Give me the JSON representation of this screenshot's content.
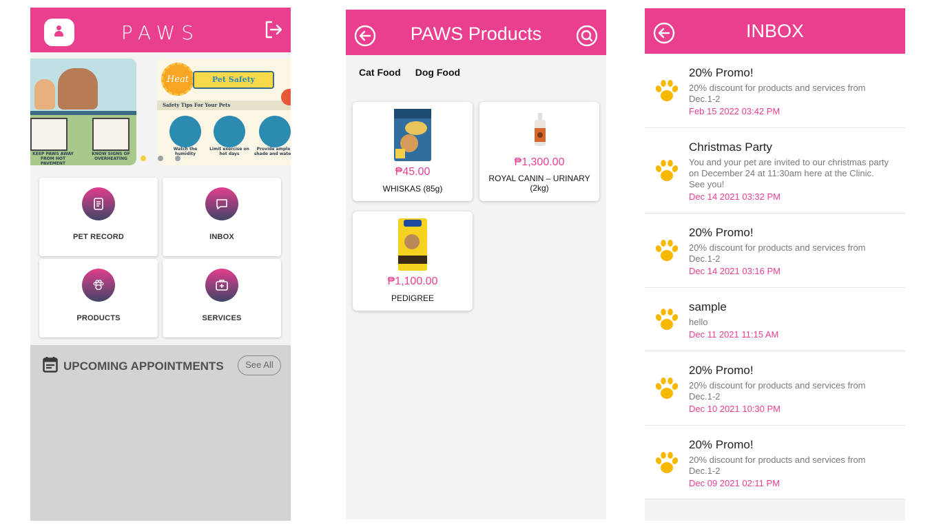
{
  "theme": {
    "accent": "#ea3e8f",
    "gradient_top": "#e23d8d",
    "gradient_bottom": "#404566"
  },
  "home": {
    "app_title": "PAWS",
    "banner_left": {
      "captions": [
        "KEEP PAWS AWAY FROM HOT PAVEMENT",
        "KNOW SIGNS OF OVERHEATING"
      ]
    },
    "banner_right": {
      "sun_text": "Heat",
      "tag_text": "Pet Safety",
      "subtitle": "Safety Tips For Your Pets",
      "tips": [
        "Watch the humidity",
        "Limit exercise on hot days",
        "Provide ample shade and water"
      ]
    },
    "carousel": {
      "pages": 3,
      "active": 0
    },
    "menu": [
      {
        "label": "PET RECORD",
        "icon": "document-icon"
      },
      {
        "label": "INBOX",
        "icon": "chat-icon"
      },
      {
        "label": "PRODUCTS",
        "icon": "paw-icon"
      },
      {
        "label": "SERVICES",
        "icon": "medical-kit-icon"
      }
    ],
    "appointments": {
      "title": "UPCOMING APPOINTMENTS",
      "see_all": "See All"
    }
  },
  "products": {
    "title": "PAWS Products",
    "categories": [
      "Cat Food",
      "Dog Food"
    ],
    "items": [
      {
        "price": "₱45.00",
        "name": "WHISKAS (85g)"
      },
      {
        "price": "₱1,300.00",
        "name": "ROYAL CANIN – URINARY (2kg)"
      },
      {
        "price": "₱1,100.00",
        "name": "PEDIGREE"
      }
    ]
  },
  "inbox": {
    "title": "INBOX",
    "messages": [
      {
        "title": "20% Promo!",
        "body": "20% discount for products and services from Dec.1-2",
        "date": "Feb 15 2022 03:42 PM"
      },
      {
        "title": "Christmas Party",
        "body": "You and your pet are invited to our christmas party on December 24 at 11:30am here at the Clinic. See you!",
        "date": "Dec 14 2021 03:32 PM"
      },
      {
        "title": "20% Promo!",
        "body": "20% discount for products and services from Dec.1-2",
        "date": "Dec 14 2021 03:16 PM"
      },
      {
        "title": "sample",
        "body": "hello",
        "date": "Dec 11 2021 11:15 AM"
      },
      {
        "title": "20% Promo!",
        "body": "20% discount for products and services from Dec.1-2",
        "date": "Dec 10 2021 10:30 PM"
      },
      {
        "title": "20% Promo!",
        "body": "20% discount for products and services from Dec.1-2",
        "date": "Dec 09 2021 02:11 PM"
      }
    ]
  }
}
